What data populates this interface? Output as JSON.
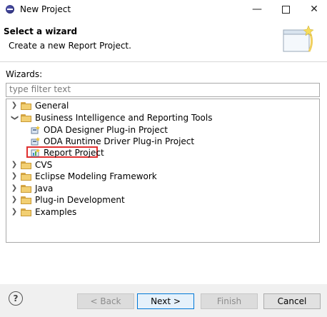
{
  "window": {
    "title": "New Project"
  },
  "header": {
    "title": "Select a wizard",
    "description": "Create a new Report Project."
  },
  "wizards_label": "Wizards:",
  "filter": {
    "placeholder": "type filter text",
    "value": ""
  },
  "tree": {
    "items": [
      {
        "label": "General",
        "expanded": false
      },
      {
        "label": "Business Intelligence and Reporting Tools",
        "expanded": true
      },
      {
        "label": "ODA Designer Plug-in Project"
      },
      {
        "label": "ODA Runtime Driver Plug-in Project"
      },
      {
        "label": "Report Project",
        "selected": true
      },
      {
        "label": "CVS",
        "expanded": false
      },
      {
        "label": "Eclipse Modeling Framework",
        "expanded": false
      },
      {
        "label": "Java",
        "expanded": false
      },
      {
        "label": "Plug-in Development",
        "expanded": false
      },
      {
        "label": "Examples",
        "expanded": false
      }
    ]
  },
  "buttons": {
    "help": "?",
    "back": "< Back",
    "next": "Next >",
    "finish": "Finish",
    "cancel": "Cancel"
  },
  "colors": {
    "selection_outline": "#e03030",
    "default_button_border": "#0078d7",
    "folder": "#f2cf72"
  }
}
